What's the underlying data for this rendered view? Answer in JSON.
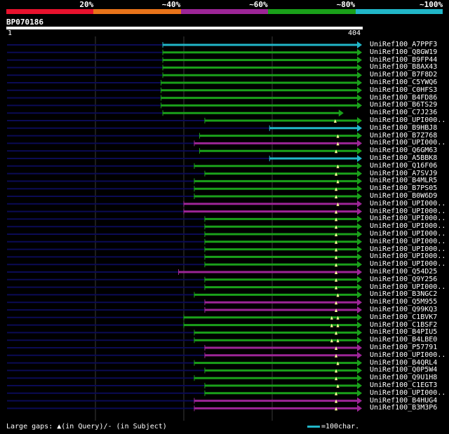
{
  "scale": {
    "labels": [
      "20%",
      "~40%",
      "~60%",
      "~80%",
      "~100%"
    ],
    "colors": [
      "#e8122d",
      "#e8731a",
      "#9c2596",
      "#1aa01a",
      "#21b6c8"
    ]
  },
  "query": {
    "title": "BP070186",
    "start_label": "1",
    "end_label": "404",
    "length": 404
  },
  "footer": {
    "gap_legend": "Large gaps: ▲(in Query)/- (in Subject)",
    "scale_legend": "=100char."
  },
  "colors": {
    "cyan": "#21b6c8",
    "green": "#1aa01a",
    "purple": "#9c2596",
    "navy": "#0b0b55",
    "marker": "#ffff99"
  },
  "chart_data": {
    "type": "alignment",
    "query_length": 404,
    "hits": [
      {
        "label": "UniRef100_A7PPF3",
        "start": 178,
        "end": 404,
        "color": "cyan",
        "markers": []
      },
      {
        "label": "UniRef100_Q8GW19",
        "start": 178,
        "end": 404,
        "color": "green",
        "markers": []
      },
      {
        "label": "UniRef100_B9FP44",
        "start": 178,
        "end": 404,
        "color": "green",
        "markers": []
      },
      {
        "label": "UniRef100_B8AX43",
        "start": 178,
        "end": 404,
        "color": "green",
        "markers": []
      },
      {
        "label": "UniRef100_B7F8D2",
        "start": 178,
        "end": 404,
        "color": "green",
        "markers": []
      },
      {
        "label": "UniRef100_C5YWQ6",
        "start": 176,
        "end": 404,
        "color": "green",
        "markers": []
      },
      {
        "label": "UniRef100_C0HFS3",
        "start": 176,
        "end": 404,
        "color": "green",
        "markers": []
      },
      {
        "label": "UniRef100_B4FD86",
        "start": 176,
        "end": 404,
        "color": "green",
        "markers": []
      },
      {
        "label": "UniRef100_B6TS29",
        "start": 176,
        "end": 404,
        "color": "green",
        "markers": []
      },
      {
        "label": "UniRef100_C7J236",
        "start": 178,
        "end": 383,
        "color": "green",
        "markers": []
      },
      {
        "label": "UniRef100_UPI000..",
        "start": 226,
        "end": 404,
        "color": "green",
        "markers": [
          375
        ]
      },
      {
        "label": "UniRef100_B9HBJ8",
        "start": 300,
        "end": 404,
        "color": "cyan",
        "markers": []
      },
      {
        "label": "UniRef100_B7Z768",
        "start": 220,
        "end": 404,
        "color": "green",
        "markers": [
          378
        ]
      },
      {
        "label": "UniRef100_UPI000..",
        "start": 214,
        "end": 404,
        "color": "purple",
        "markers": [
          378
        ]
      },
      {
        "label": "UniRef100_Q6GM63",
        "start": 220,
        "end": 404,
        "color": "green",
        "markers": [
          376
        ]
      },
      {
        "label": "UniRef100_A5BBK8",
        "start": 300,
        "end": 404,
        "color": "cyan",
        "markers": []
      },
      {
        "label": "UniRef100_Q16F06",
        "start": 214,
        "end": 404,
        "color": "green",
        "markers": [
          378
        ]
      },
      {
        "label": "UniRef100_A7SVJ9",
        "start": 226,
        "end": 404,
        "color": "green",
        "markers": [
          376
        ]
      },
      {
        "label": "UniRef100_B4MLR5",
        "start": 214,
        "end": 404,
        "color": "green",
        "markers": [
          378
        ]
      },
      {
        "label": "UniRef100_B7PS05",
        "start": 214,
        "end": 404,
        "color": "green",
        "markers": [
          376
        ]
      },
      {
        "label": "UniRef100_B0W6D9",
        "start": 214,
        "end": 404,
        "color": "green",
        "markers": [
          376
        ]
      },
      {
        "label": "UniRef100_UPI000..",
        "start": 202,
        "end": 404,
        "color": "purple",
        "markers": [
          378
        ]
      },
      {
        "label": "UniRef100_UPI000..",
        "start": 202,
        "end": 404,
        "color": "purple",
        "markers": [
          376
        ]
      },
      {
        "label": "UniRef100_UPI000..",
        "start": 226,
        "end": 404,
        "color": "green",
        "markers": [
          376
        ]
      },
      {
        "label": "UniRef100_UPI000..",
        "start": 226,
        "end": 404,
        "color": "green",
        "markers": [
          376
        ]
      },
      {
        "label": "UniRef100_UPI000..",
        "start": 226,
        "end": 404,
        "color": "green",
        "markers": [
          376
        ]
      },
      {
        "label": "UniRef100_UPI000..",
        "start": 226,
        "end": 404,
        "color": "green",
        "markers": [
          376
        ]
      },
      {
        "label": "UniRef100_UPI000..",
        "start": 226,
        "end": 404,
        "color": "green",
        "markers": [
          376
        ]
      },
      {
        "label": "UniRef100_UPI000..",
        "start": 226,
        "end": 404,
        "color": "green",
        "markers": [
          376
        ]
      },
      {
        "label": "UniRef100_UPI000..",
        "start": 226,
        "end": 404,
        "color": "green",
        "markers": [
          376
        ]
      },
      {
        "label": "UniRef100_Q54D25",
        "start": 196,
        "end": 404,
        "color": "purple",
        "markers": [
          376
        ]
      },
      {
        "label": "UniRef100_Q9Y256",
        "start": 226,
        "end": 404,
        "color": "green",
        "markers": [
          376
        ]
      },
      {
        "label": "UniRef100_UPI000..",
        "start": 226,
        "end": 404,
        "color": "green",
        "markers": [
          376
        ]
      },
      {
        "label": "UniRef100_B3NGC2",
        "start": 214,
        "end": 404,
        "color": "green",
        "markers": [
          378
        ]
      },
      {
        "label": "UniRef100_Q5M955",
        "start": 226,
        "end": 404,
        "color": "purple",
        "markers": [
          376
        ]
      },
      {
        "label": "UniRef100_Q99KQ3",
        "start": 226,
        "end": 404,
        "color": "purple",
        "markers": [
          376
        ]
      },
      {
        "label": "UniRef100_C1BVK7",
        "start": 202,
        "end": 404,
        "color": "green",
        "markers": [
          371,
          378
        ]
      },
      {
        "label": "UniRef100_C1BSF2",
        "start": 202,
        "end": 404,
        "color": "green",
        "markers": [
          371,
          378
        ]
      },
      {
        "label": "UniRef100_B4PIU5",
        "start": 214,
        "end": 404,
        "color": "green",
        "markers": [
          376
        ]
      },
      {
        "label": "UniRef100_B4LBE0",
        "start": 214,
        "end": 404,
        "color": "green",
        "markers": [
          371,
          378
        ]
      },
      {
        "label": "UniRef100_P57791",
        "start": 226,
        "end": 404,
        "color": "purple",
        "markers": [
          376
        ]
      },
      {
        "label": "UniRef100_UPI000..",
        "start": 226,
        "end": 404,
        "color": "purple",
        "markers": [
          376
        ]
      },
      {
        "label": "UniRef100_B4QRL4",
        "start": 214,
        "end": 404,
        "color": "green",
        "markers": [
          378
        ]
      },
      {
        "label": "UniRef100_Q0P5W4",
        "start": 226,
        "end": 404,
        "color": "green",
        "markers": [
          376
        ]
      },
      {
        "label": "UniRef100_Q9U1H8",
        "start": 214,
        "end": 404,
        "color": "green",
        "markers": [
          376
        ]
      },
      {
        "label": "UniRef100_C1EGT3",
        "start": 226,
        "end": 404,
        "color": "green",
        "markers": [
          378
        ]
      },
      {
        "label": "UniRef100_UPI000..",
        "start": 226,
        "end": 404,
        "color": "green",
        "markers": [
          376
        ]
      },
      {
        "label": "UniRef100_B4HUG4",
        "start": 214,
        "end": 404,
        "color": "purple",
        "markers": [
          376
        ]
      },
      {
        "label": "UniRef100_B3M3P6",
        "start": 214,
        "end": 404,
        "color": "purple",
        "markers": [
          376
        ]
      }
    ]
  }
}
